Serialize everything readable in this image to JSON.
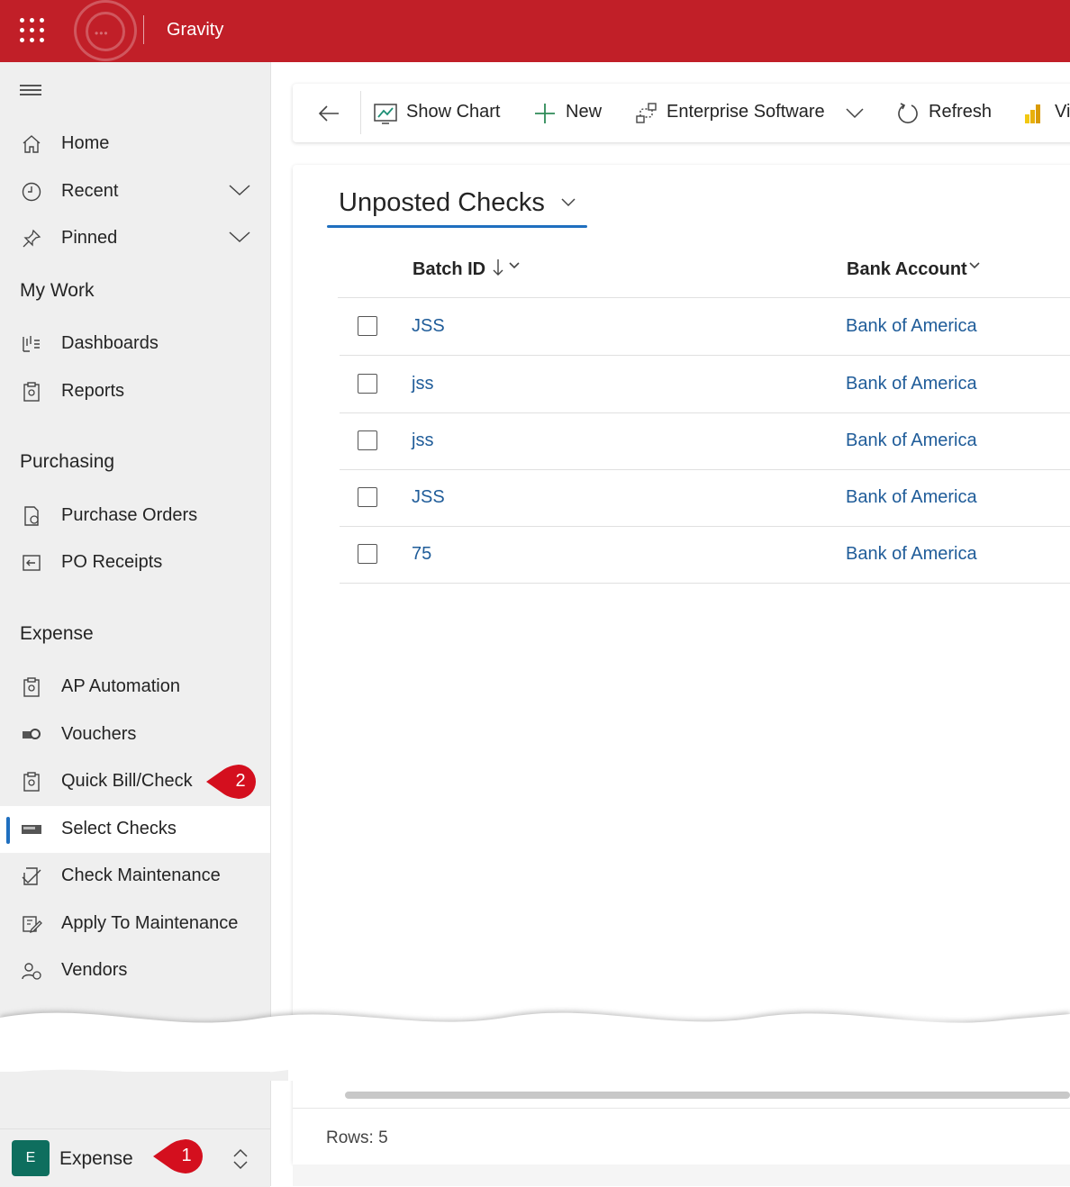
{
  "app": {
    "title": "Gravity"
  },
  "sidebar": {
    "items_top": [
      {
        "label": "Home",
        "icon": "home-icon"
      },
      {
        "label": "Recent",
        "icon": "clock-icon",
        "expandable": true
      },
      {
        "label": "Pinned",
        "icon": "pin-icon",
        "expandable": true
      }
    ],
    "sections": [
      {
        "title": "My Work",
        "items": [
          {
            "label": "Dashboards",
            "icon": "dashboard-icon"
          },
          {
            "label": "Reports",
            "icon": "report-icon"
          }
        ]
      },
      {
        "title": "Purchasing",
        "items": [
          {
            "label": "Purchase Orders",
            "icon": "purchase-order-icon"
          },
          {
            "label": "PO Receipts",
            "icon": "receipt-icon"
          }
        ]
      },
      {
        "title": "Expense",
        "items": [
          {
            "label": "AP Automation",
            "icon": "report-icon"
          },
          {
            "label": "Vouchers",
            "icon": "voucher-icon"
          },
          {
            "label": "Quick Bill/Check",
            "icon": "report-icon"
          },
          {
            "label": "Select Checks",
            "icon": "check-card-icon",
            "selected": true
          },
          {
            "label": "Check Maintenance",
            "icon": "check-edit-icon"
          },
          {
            "label": "Apply To Maintenance",
            "icon": "apply-icon"
          },
          {
            "label": "Vendors",
            "icon": "vendor-icon"
          }
        ]
      }
    ],
    "area": {
      "tile": "E",
      "label": "Expense"
    }
  },
  "badges": {
    "quick_bill": "2",
    "area": "1"
  },
  "commands": {
    "show_chart": "Show Chart",
    "new": "New",
    "enterprise": "Enterprise Software",
    "refresh": "Refresh",
    "overflow": "Vi"
  },
  "view": {
    "title": "Unposted Checks",
    "columns": {
      "batch_id": "Batch ID",
      "bank_account": "Bank Account"
    },
    "rows": [
      {
        "batch_id": "JSS",
        "bank_account": "Bank of America"
      },
      {
        "batch_id": "jss",
        "bank_account": "Bank of America"
      },
      {
        "batch_id": "jss",
        "bank_account": "Bank of America"
      },
      {
        "batch_id": "JSS",
        "bank_account": "Bank of America"
      },
      {
        "batch_id": "75",
        "bank_account": "Bank of America"
      }
    ],
    "rows_count": "Rows: 5"
  },
  "colors": {
    "brand": "#c11f28",
    "accent": "#1f6fbf",
    "link": "#1f5c99",
    "badge": "#d40f1e",
    "area_tile": "#0e6e5e"
  }
}
